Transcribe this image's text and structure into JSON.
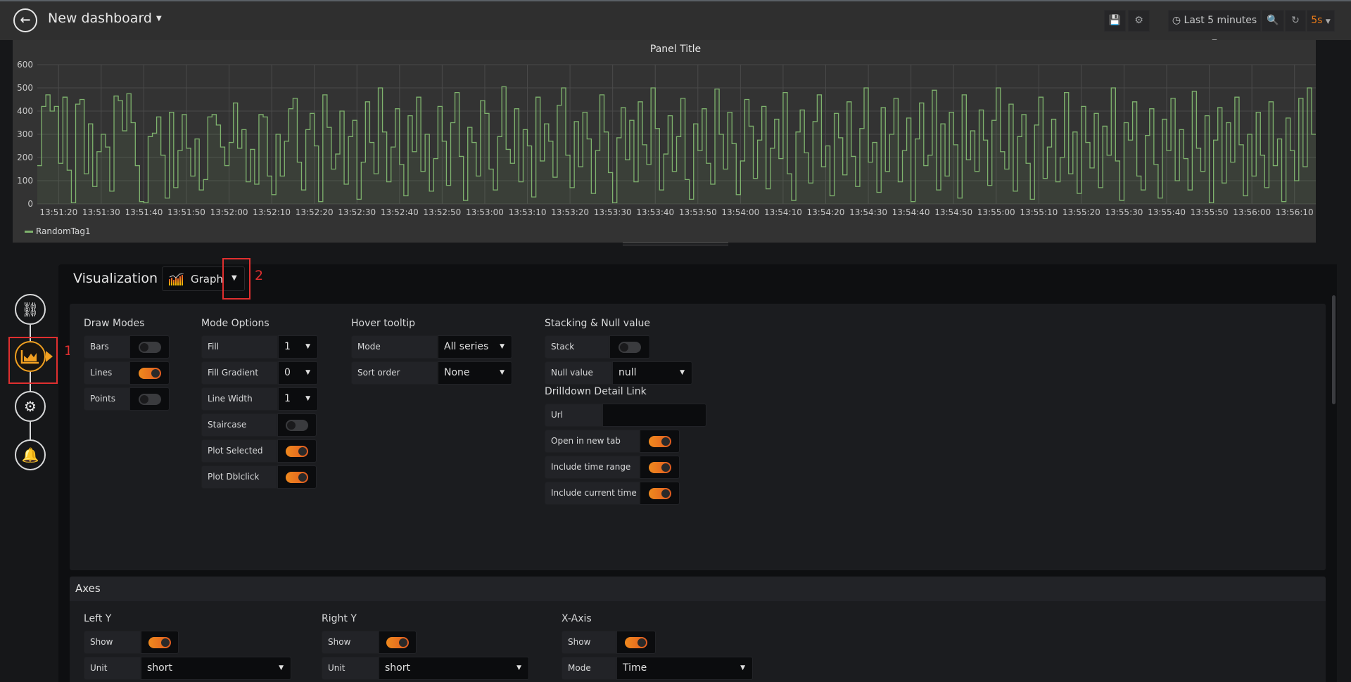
{
  "nav": {
    "back_icon": "arrow-left-circle-icon",
    "dashboard_title": "New dashboard",
    "time_range": "Last 5 minutes",
    "refresh_interval": "5s",
    "refresh_color": "#eb7b18"
  },
  "panel": {
    "title": "Panel Title"
  },
  "chart_data": {
    "type": "line",
    "style": "staircase line with light area fill",
    "series": [
      {
        "name": "RandomTag1",
        "color": "#7eb26d",
        "x_start": "13:51:15",
        "x_step_seconds": 1,
        "values": [
          165,
          420,
          470,
          400,
          420,
          175,
          460,
          145,
          5,
          430,
          450,
          130,
          345,
          75,
          225,
          300,
          245,
          55,
          465,
          445,
          315,
          475,
          350,
          165,
          10,
          5,
          290,
          305,
          375,
          210,
          25,
          395,
          70,
          230,
          385,
          240,
          120,
          280,
          60,
          105,
          375,
          385,
          340,
          245,
          165,
          265,
          435,
          240,
          320,
          95,
          235,
          85,
          385,
          375,
          120,
          40,
          300,
          120,
          270,
          410,
          455,
          180,
          60,
          320,
          390,
          250,
          10,
          470,
          330,
          150,
          215,
          400,
          85,
          290,
          360,
          20,
          180,
          440,
          265,
          130,
          500,
          310,
          95,
          245,
          410,
          170,
          35,
          380,
          225,
          460,
          140,
          300,
          55,
          195,
          420,
          270,
          80,
          350,
          480,
          205,
          15,
          330,
          265,
          120,
          445,
          390,
          150,
          60,
          290,
          505,
          235,
          175,
          410,
          95,
          320,
          250,
          30,
          460,
          185,
          345,
          270,
          115,
          425,
          500,
          210,
          70,
          355,
          160,
          395,
          280,
          45,
          230,
          470,
          310,
          135,
          5,
          285,
          415,
          190,
          360,
          95,
          440,
          255,
          170,
          500,
          325,
          60,
          215,
          380,
          140,
          290,
          455,
          105,
          20,
          345,
          230,
          410,
          175,
          85,
          495,
          300,
          150,
          395,
          260,
          40,
          185,
          450,
          335,
          110,
          275,
          420,
          65,
          240,
          365,
          195,
          480,
          130,
          15,
          310,
          405,
          220,
          90,
          355,
          470,
          160,
          250,
          35,
          390,
          285,
          125,
          440,
          205,
          75,
          325,
          500,
          180,
          265,
          50,
          415,
          140,
          300,
          455,
          95,
          230,
          370,
          10,
          280,
          435,
          165,
          210,
          490,
          60,
          345,
          120,
          395,
          255,
          25,
          470,
          190,
          315,
          140,
          405,
          275,
          80,
          360,
          500,
          225,
          150,
          430,
          55,
          290,
          385,
          175,
          20,
          340,
          460,
          110,
          245,
          365,
          95,
          200,
          480,
          130,
          310,
          45,
          420,
          265,
          155,
          390,
          70,
          335,
          210,
          500,
          185,
          15,
          350,
          275,
          440,
          120,
          60,
          295,
          410,
          170,
          25,
          365,
          230,
          455,
          100,
          320,
          195,
          60,
          485,
          240,
          140,
          380,
          5,
          275,
          415,
          90,
          350,
          180,
          460,
          255,
          35,
          300,
          120,
          395,
          210,
          70,
          440,
          165,
          280,
          10,
          370,
          230,
          100,
          455,
          160,
          500,
          300
        ]
      }
    ],
    "ylim": [
      0,
      600
    ],
    "yticks": [
      "0",
      "100",
      "200",
      "300",
      "400",
      "500",
      "600"
    ],
    "xticks": [
      "13:51:20",
      "13:51:30",
      "13:51:40",
      "13:51:50",
      "13:52:00",
      "13:52:10",
      "13:52:20",
      "13:52:30",
      "13:52:40",
      "13:52:50",
      "13:53:00",
      "13:53:10",
      "13:53:20",
      "13:53:30",
      "13:53:40",
      "13:53:50",
      "13:54:00",
      "13:54:10",
      "13:54:20",
      "13:54:30",
      "13:54:40",
      "13:54:50",
      "13:55:00",
      "13:55:10",
      "13:55:20",
      "13:55:30",
      "13:55:40",
      "13:55:50",
      "13:56:00",
      "13:56:10"
    ],
    "xlim": [
      "13:51:15",
      "13:56:15"
    ],
    "grid": true,
    "legend": "bottom-left"
  },
  "editor": {
    "steps": [
      "database-icon",
      "graph-area-icon",
      "settings-wrench-icon",
      "bell-icon"
    ],
    "annotation_1": "1",
    "annotation_2": "2",
    "visualization_label": "Visualization",
    "visualization_type": "Graph",
    "draw_modes": {
      "title": "Draw Modes",
      "bars": {
        "label": "Bars",
        "on": false
      },
      "lines": {
        "label": "Lines",
        "on": true
      },
      "points": {
        "label": "Points",
        "on": false
      }
    },
    "mode_options": {
      "title": "Mode Options",
      "fill": {
        "label": "Fill",
        "value": "1"
      },
      "fill_gradient": {
        "label": "Fill Gradient",
        "value": "0"
      },
      "line_width": {
        "label": "Line Width",
        "value": "1"
      },
      "staircase": {
        "label": "Staircase",
        "on": false
      },
      "plot_selected": {
        "label": "Plot Selected",
        "on": true
      },
      "plot_dblclick": {
        "label": "Plot Dblclick",
        "on": true
      }
    },
    "hover_tooltip": {
      "title": "Hover tooltip",
      "mode": {
        "label": "Mode",
        "value": "All series"
      },
      "sort": {
        "label": "Sort order",
        "value": "None"
      }
    },
    "stacking": {
      "title": "Stacking & Null value",
      "stack": {
        "label": "Stack",
        "on": false
      },
      "null_value": {
        "label": "Null value",
        "value": "null"
      }
    },
    "drilldown": {
      "title": "Drilldown Detail Link",
      "url": {
        "label": "Url",
        "value": ""
      },
      "new_tab": {
        "label": "Open in new tab",
        "on": true
      },
      "time_range": {
        "label": "Include time range",
        "on": true
      },
      "current_time": {
        "label": "Include current time",
        "on": true
      }
    },
    "axes": {
      "title": "Axes",
      "left_y": {
        "title": "Left Y",
        "show": {
          "label": "Show",
          "on": true
        },
        "unit": {
          "label": "Unit",
          "value": "short"
        }
      },
      "right_y": {
        "title": "Right Y",
        "show": {
          "label": "Show",
          "on": true
        },
        "unit": {
          "label": "Unit",
          "value": "short"
        }
      },
      "x_axis": {
        "title": "X-Axis",
        "show": {
          "label": "Show",
          "on": true
        },
        "mode": {
          "label": "Mode",
          "value": "Time"
        }
      }
    }
  }
}
